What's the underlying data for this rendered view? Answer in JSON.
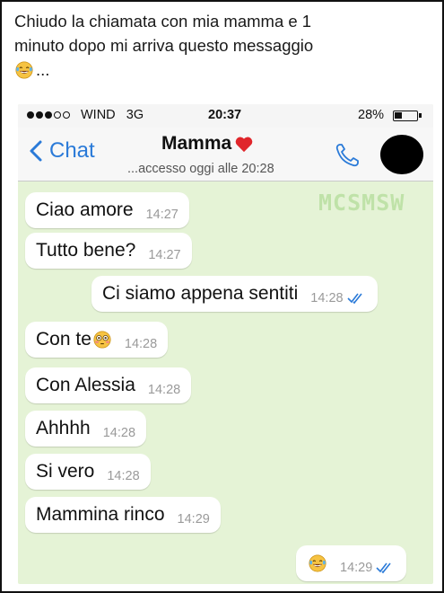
{
  "caption": {
    "line1": "Chiudo la chiamata con mia mamma e 1",
    "line2": "minuto dopo mi arriva questo messaggio",
    "line3_suffix": "...",
    "emoji": "laughing-tears-emoji"
  },
  "status_bar": {
    "carrier": "WIND",
    "network": "3G",
    "time": "20:37",
    "battery": "28%",
    "battery_level": 0.28
  },
  "nav": {
    "back_label": "Chat",
    "contact_name": "Mamma",
    "name_emoji": "heart-icon",
    "last_seen": "...accesso oggi alle 20:28"
  },
  "watermark": "MCSMSW",
  "colors": {
    "chat_background": "#e5f3d6",
    "accent": "#2a7ad8",
    "read_ticks": "#2a7ad8",
    "bubble": "#ffffff"
  },
  "messages": [
    {
      "text": "Ciao amore",
      "time": "14:27",
      "direction": "in"
    },
    {
      "text": "Tutto bene?",
      "time": "14:27",
      "direction": "in"
    },
    {
      "text": "Ci siamo appena sentiti",
      "time": "14:28",
      "direction": "out"
    },
    {
      "text": "Con te",
      "time": "14:28",
      "direction": "in",
      "emoji": "flushed-face-emoji"
    },
    {
      "text": "Con Alessia",
      "time": "14:28",
      "direction": "in"
    },
    {
      "text": "Ahhhh",
      "time": "14:28",
      "direction": "in"
    },
    {
      "text": "Si vero",
      "time": "14:28",
      "direction": "in"
    },
    {
      "text": "Mammina rinco",
      "time": "14:29",
      "direction": "in"
    },
    {
      "text": "",
      "time": "14:29",
      "direction": "out",
      "emoji": "laughing-tears-emoji"
    }
  ]
}
